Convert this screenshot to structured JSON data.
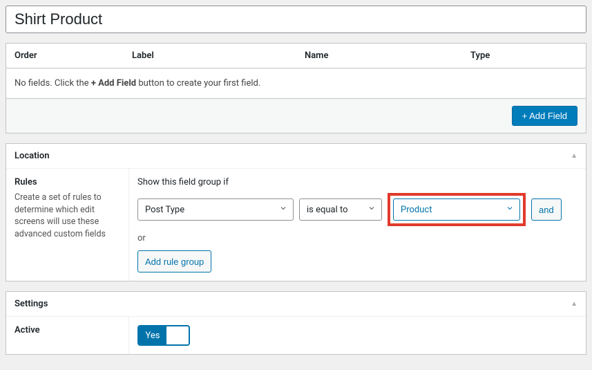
{
  "title": "Shirt Product",
  "fields_table": {
    "headers": {
      "order": "Order",
      "label": "Label",
      "name": "Name",
      "type": "Type"
    },
    "empty_pre": "No fields. Click the ",
    "empty_strong": "+ Add Field",
    "empty_post": " button to create your first field.",
    "add_button": "+ Add Field"
  },
  "location": {
    "title": "Location",
    "rules_label": "Rules",
    "rules_desc": "Create a set of rules to determine which edit screens will use these advanced custom fields",
    "show_if": "Show this field group if",
    "param": "Post Type",
    "operator": "is equal to",
    "value": "Product",
    "and": "and",
    "or": "or",
    "add_rule_group": "Add rule group"
  },
  "settings": {
    "title": "Settings",
    "active_label": "Active",
    "active_value": "Yes"
  }
}
